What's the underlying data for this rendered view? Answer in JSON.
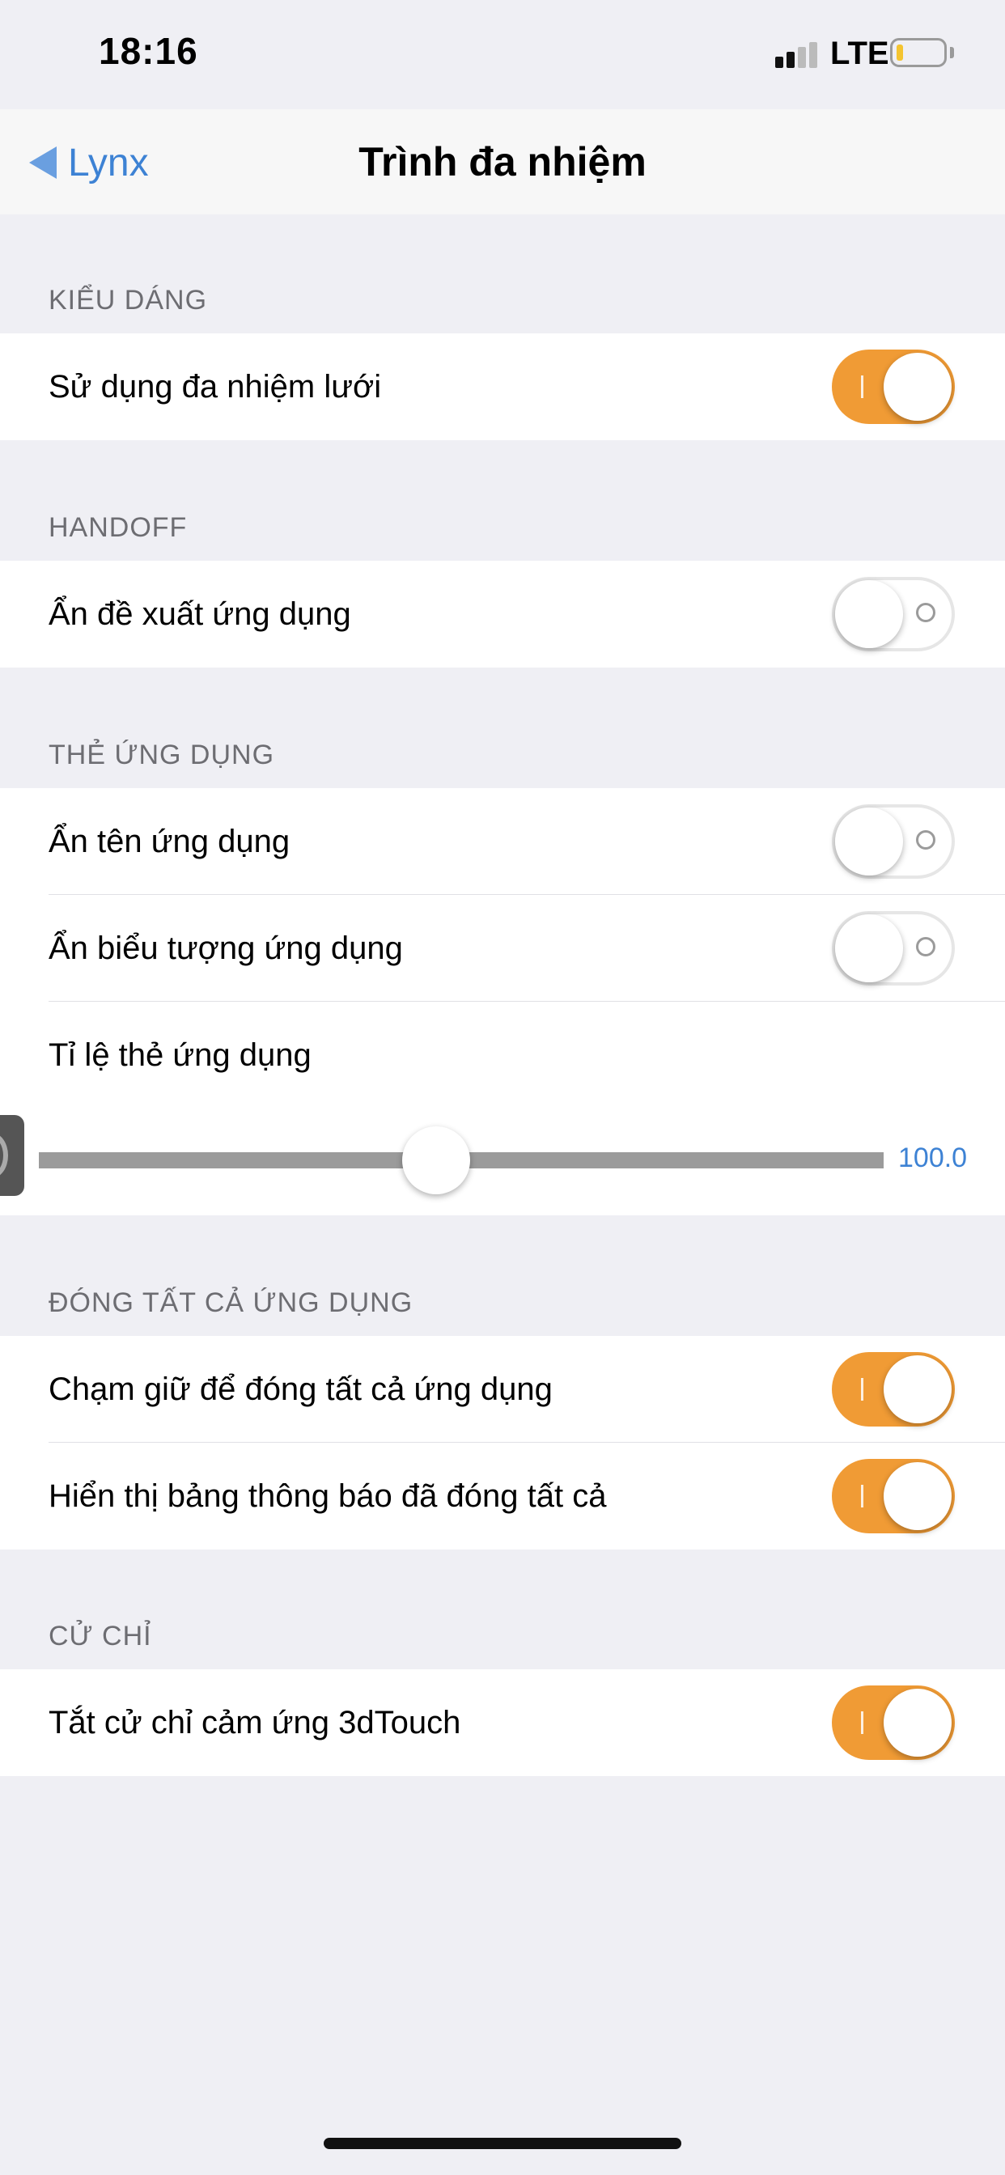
{
  "status_bar": {
    "time": "18:16",
    "network": "LTE",
    "battery_level": 0.15
  },
  "nav": {
    "back_label": "Lynx",
    "title": "Trình đa nhiệm"
  },
  "sections": [
    {
      "header": "KIỂU DÁNG",
      "rows": [
        {
          "label": "Sử dụng đa nhiệm lưới",
          "on": true
        }
      ]
    },
    {
      "header": "HANDOFF",
      "rows": [
        {
          "label": "Ẩn đề xuất ứng dụng",
          "on": false
        }
      ]
    },
    {
      "header": "THẺ ỨNG DỤNG",
      "rows": [
        {
          "label": "Ẩn tên ứng dụng",
          "on": false
        },
        {
          "label": "Ẩn biểu tượng ứng dụng",
          "on": false
        },
        {
          "label": "Tỉ lệ thẻ ứng dụng"
        }
      ],
      "slider": {
        "value": "100.0",
        "position": 0.47
      }
    },
    {
      "header": "ĐÓNG TẤT CẢ ỨNG DỤNG",
      "rows": [
        {
          "label": "Chạm giữ để đóng tất cả ứng dụng",
          "on": true
        },
        {
          "label": "Hiển thị bảng thông báo đã đóng tất cả",
          "on": true
        }
      ]
    },
    {
      "header": "CỬ CHỈ",
      "rows": [
        {
          "label": "Tắt cử chỉ cảm ứng 3dTouch",
          "on": true
        }
      ]
    }
  ],
  "colors": {
    "accent_toggle": "#f09b35",
    "link_blue": "#3d82d4",
    "background": "#efeff4"
  }
}
